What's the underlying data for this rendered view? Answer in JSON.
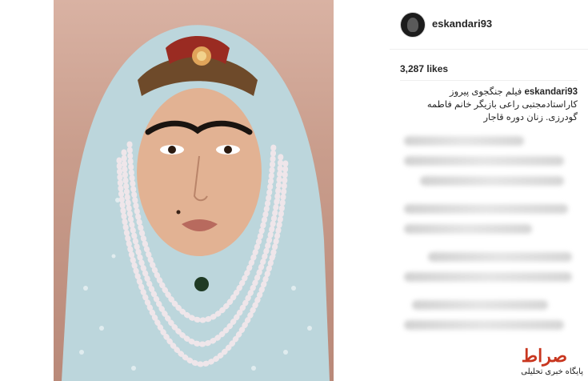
{
  "post": {
    "username": "eskandari93",
    "likes": "3,287 likes",
    "caption_user": "eskandari93",
    "caption_text": "فیلم جنگجوی پیروز کاراستادمجتبی راعی بازیگر خانم فاطمه گودرزی. زنان دوره قاجار"
  },
  "photo": {
    "subject": "portrait-woman-qajar-costume"
  },
  "watermark": {
    "logo": "صراط",
    "text": "پایگاه خبری تحلیلی"
  },
  "colors": {
    "scarf": "#bcd6dc",
    "background": "#c99d8c",
    "username": "#262626",
    "watermark_red": "#c8361f"
  }
}
